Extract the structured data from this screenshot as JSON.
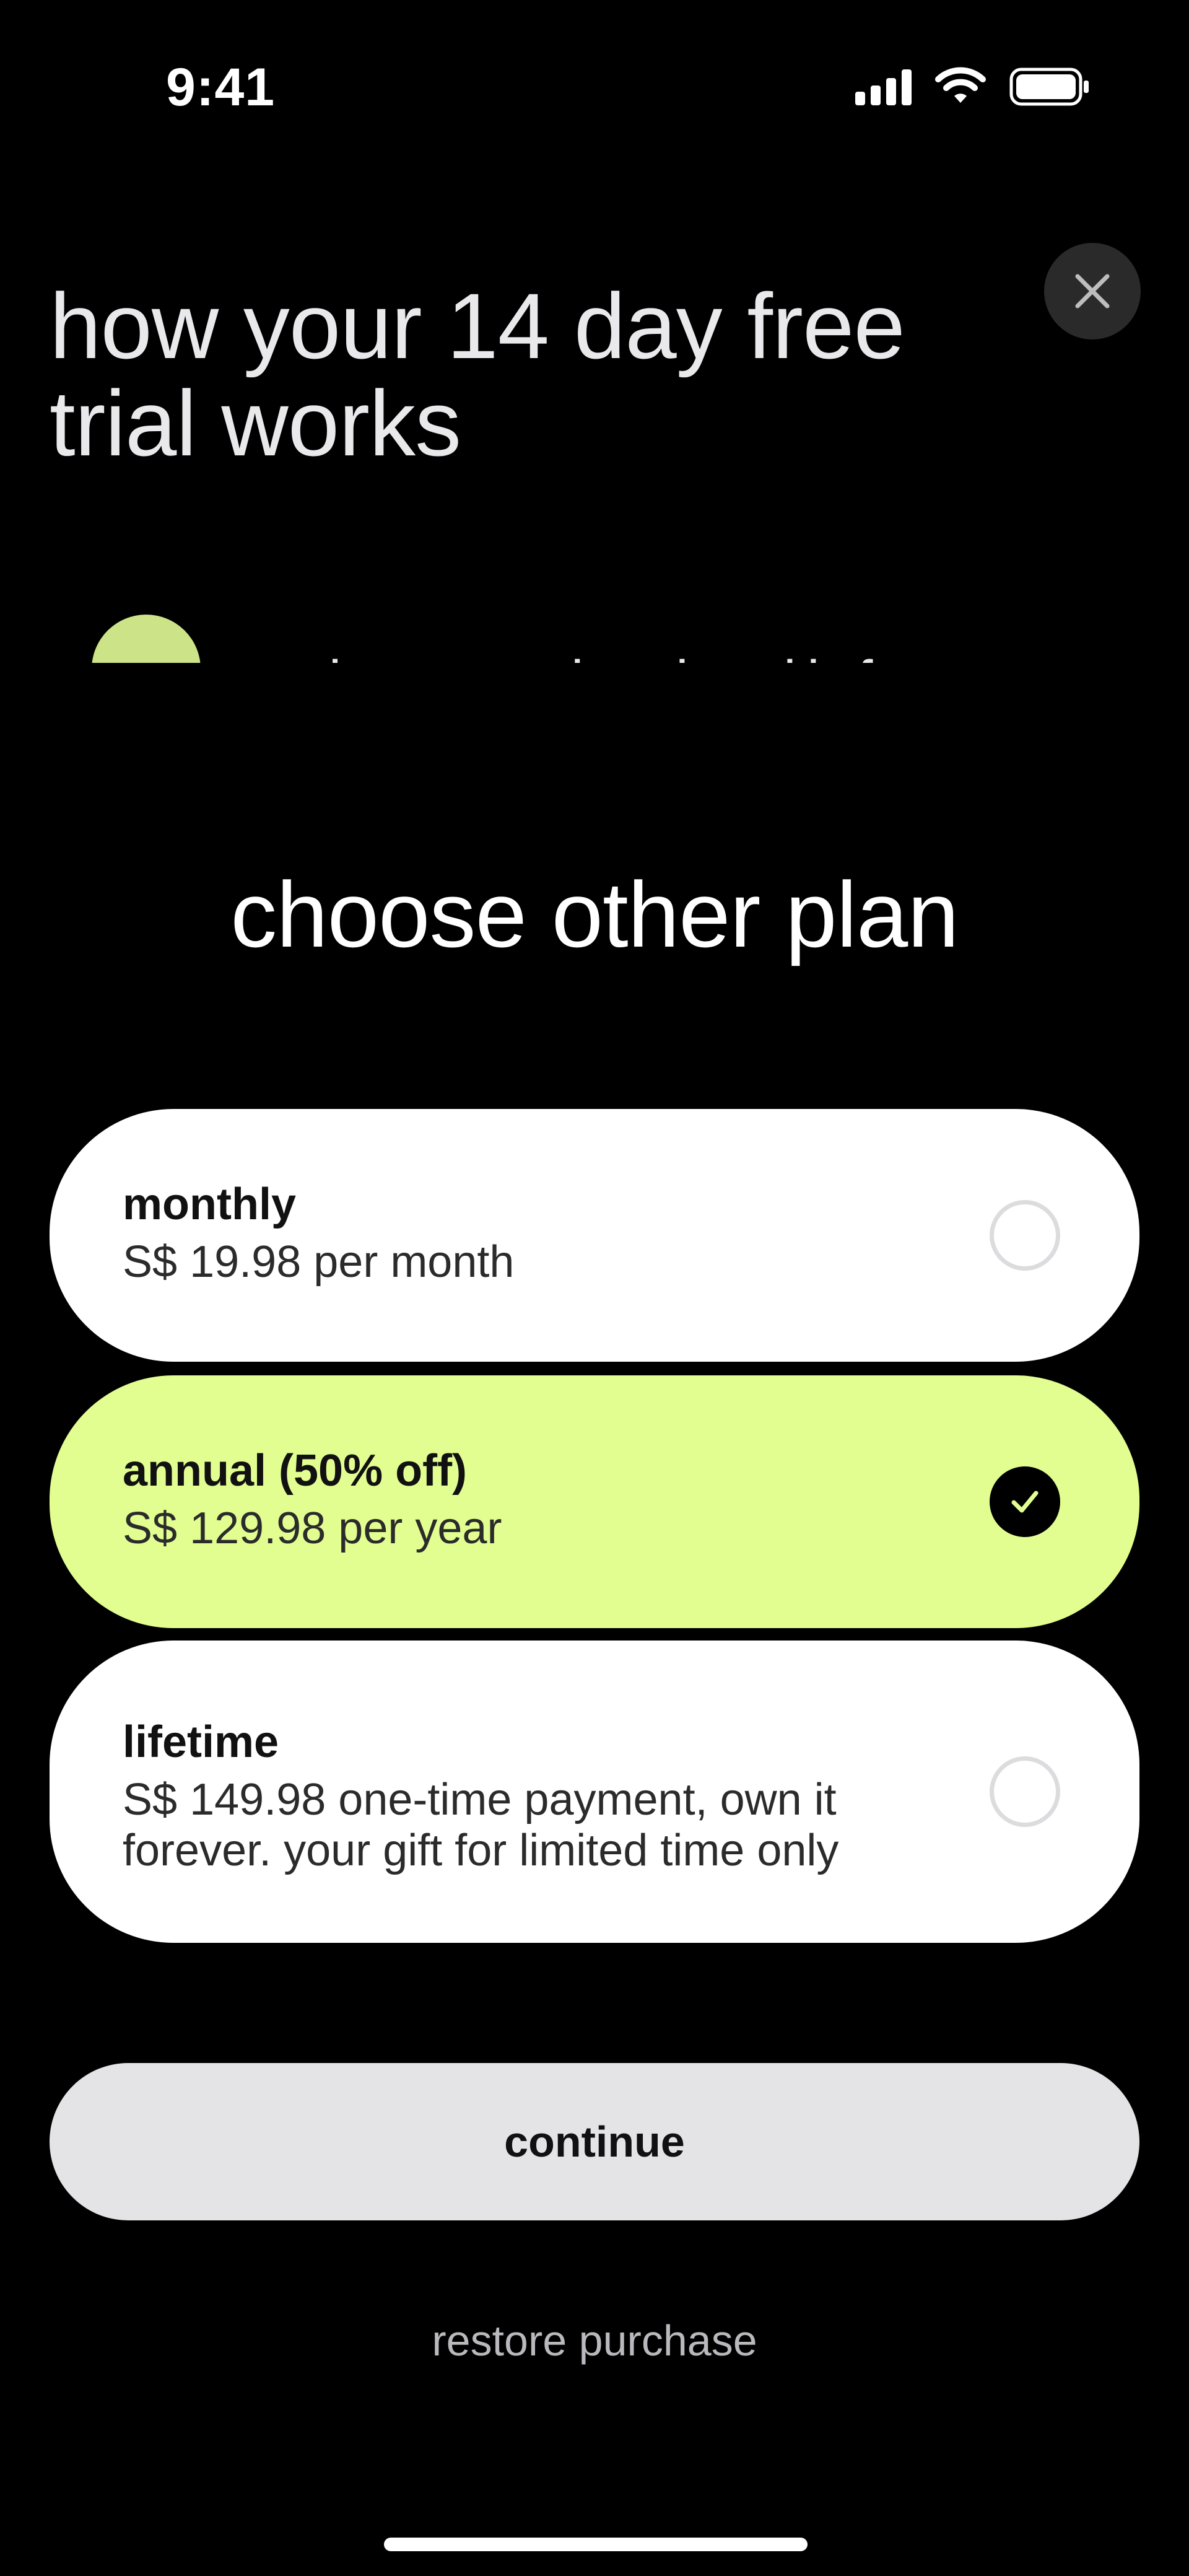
{
  "status_bar": {
    "time": "9:41",
    "icons": [
      "signal-icon",
      "wifi-icon",
      "battery-icon"
    ]
  },
  "header": {
    "close_icon": "close-icon",
    "title": "how your 14 day free trial works",
    "peek_text": "today: unlock all features"
  },
  "plans_section": {
    "title": "choose other plan",
    "plans": [
      {
        "name": "monthly",
        "price": "S$ 19.98 per month",
        "selected": false
      },
      {
        "name": "annual (50% off)",
        "price": "S$ 129.98 per year",
        "selected": true
      },
      {
        "name": "lifetime",
        "price": "S$ 149.98 one-time payment, own it forever. your gift for limited time only",
        "selected": false
      }
    ]
  },
  "actions": {
    "continue_label": "continue",
    "restore_label": "restore purchase"
  },
  "colors": {
    "background": "#000000",
    "selected_plan": "#e2fe91",
    "card": "#ffffff",
    "button": "#e4e4e7"
  }
}
